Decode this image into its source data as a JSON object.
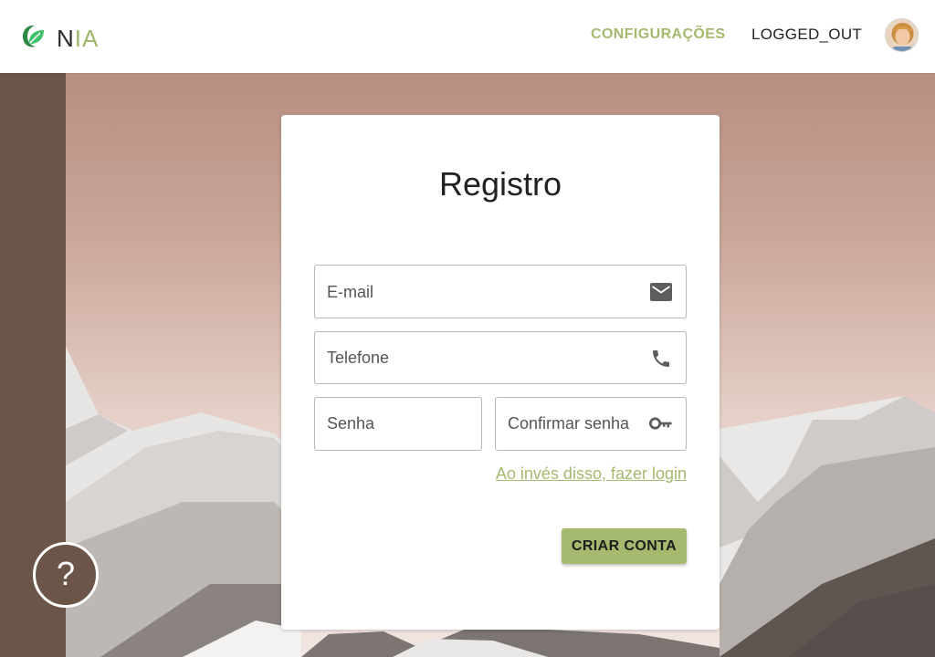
{
  "header": {
    "logo_n": "N",
    "logo_ia": "IA",
    "nav_config": "CONFIGURAÇÕES",
    "nav_login": "LOGGED_OUT",
    "avatar_icon": "user-avatar"
  },
  "form": {
    "title": "Registro",
    "email_label": "E-mail",
    "phone_label": "Telefone",
    "password_label": "Senha",
    "confirm_label": "Confirmar senha",
    "login_link": "Ao invés disso, fazer login",
    "create_button": "CRIAR CONTA",
    "icons": [
      "email-icon",
      "phone-icon",
      "key-icon"
    ]
  },
  "help": {
    "label": "?"
  },
  "colors": {
    "accent": "#a5b96f",
    "logo_green": "#9bb86b",
    "sidebar": "#6b5549"
  }
}
